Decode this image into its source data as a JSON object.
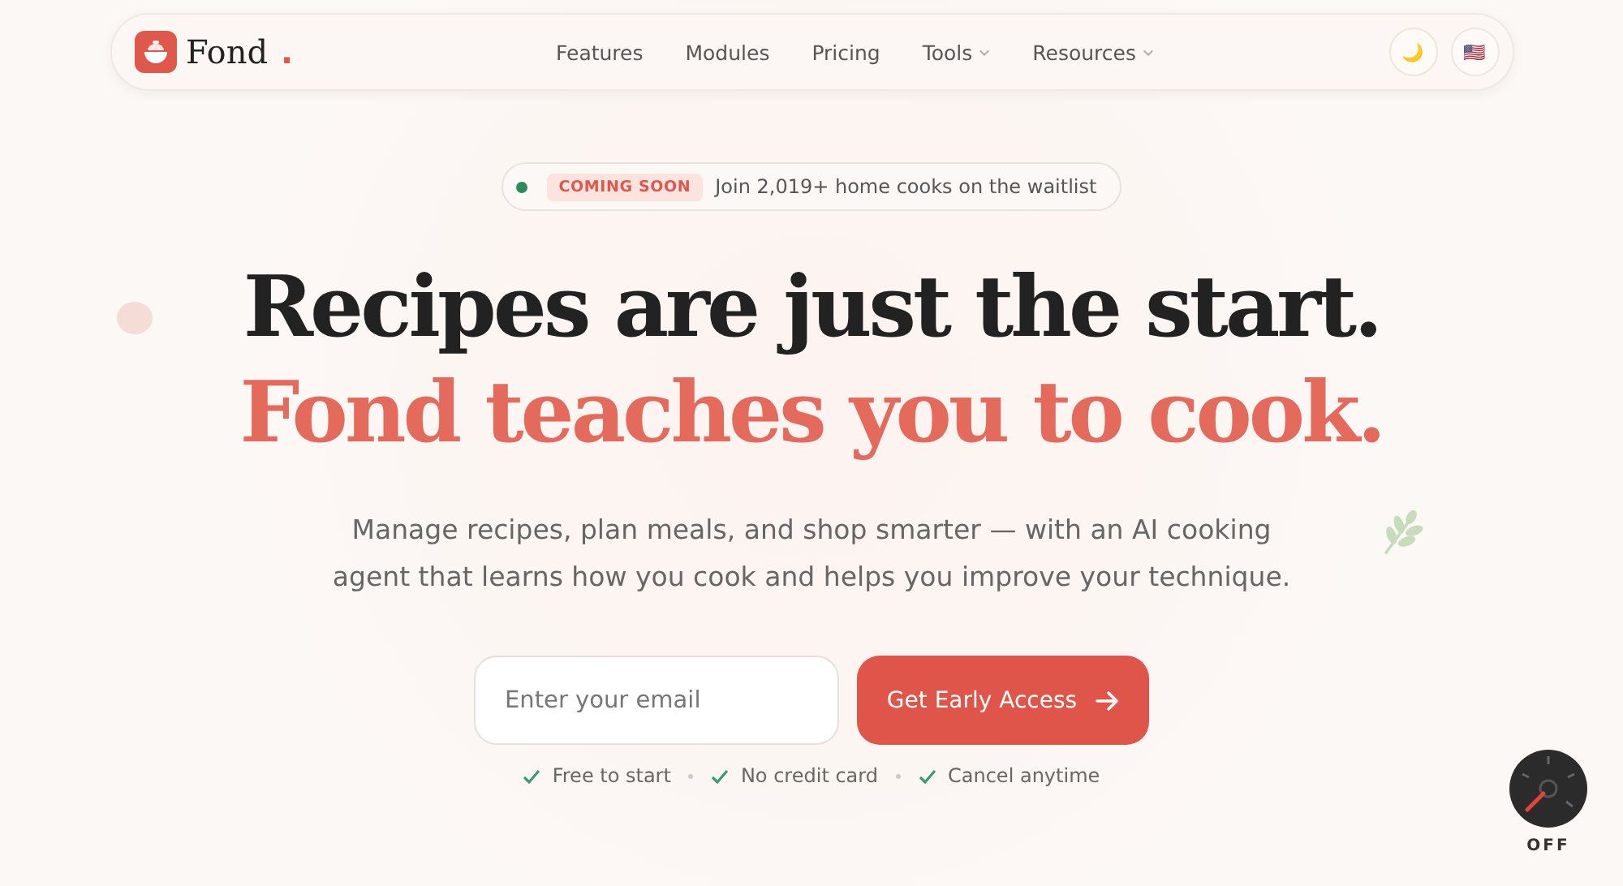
{
  "nav": {
    "logo": {
      "name": "Fond",
      "mark": "."
    },
    "links": [
      {
        "label": "Features",
        "dropdown": false
      },
      {
        "label": "Modules",
        "dropdown": false
      },
      {
        "label": "Pricing",
        "dropdown": false
      },
      {
        "label": "Tools",
        "dropdown": true
      },
      {
        "label": "Resources",
        "dropdown": true
      }
    ],
    "actions": [
      {
        "kind": "theme",
        "icon": "🌙"
      },
      {
        "kind": "language",
        "icon": "🇺🇸"
      }
    ]
  },
  "announcement": {
    "tag": "COMING SOON",
    "text": "Join 2,019+ home cooks on the waitlist"
  },
  "hero": {
    "title": "Recipes are just the start.",
    "subtitle": "Fond teaches you to cook.",
    "description": "Manage recipes, plan meals, and shop smarter — with an AI cooking agent that learns how you cook and helps you improve your technique."
  },
  "signup": {
    "placeholder": "Enter your email",
    "button": "Get Early Access",
    "perks": [
      "Free to start",
      "No credit card",
      "Cancel anytime"
    ]
  },
  "gauge": {
    "label": "OFF"
  }
}
